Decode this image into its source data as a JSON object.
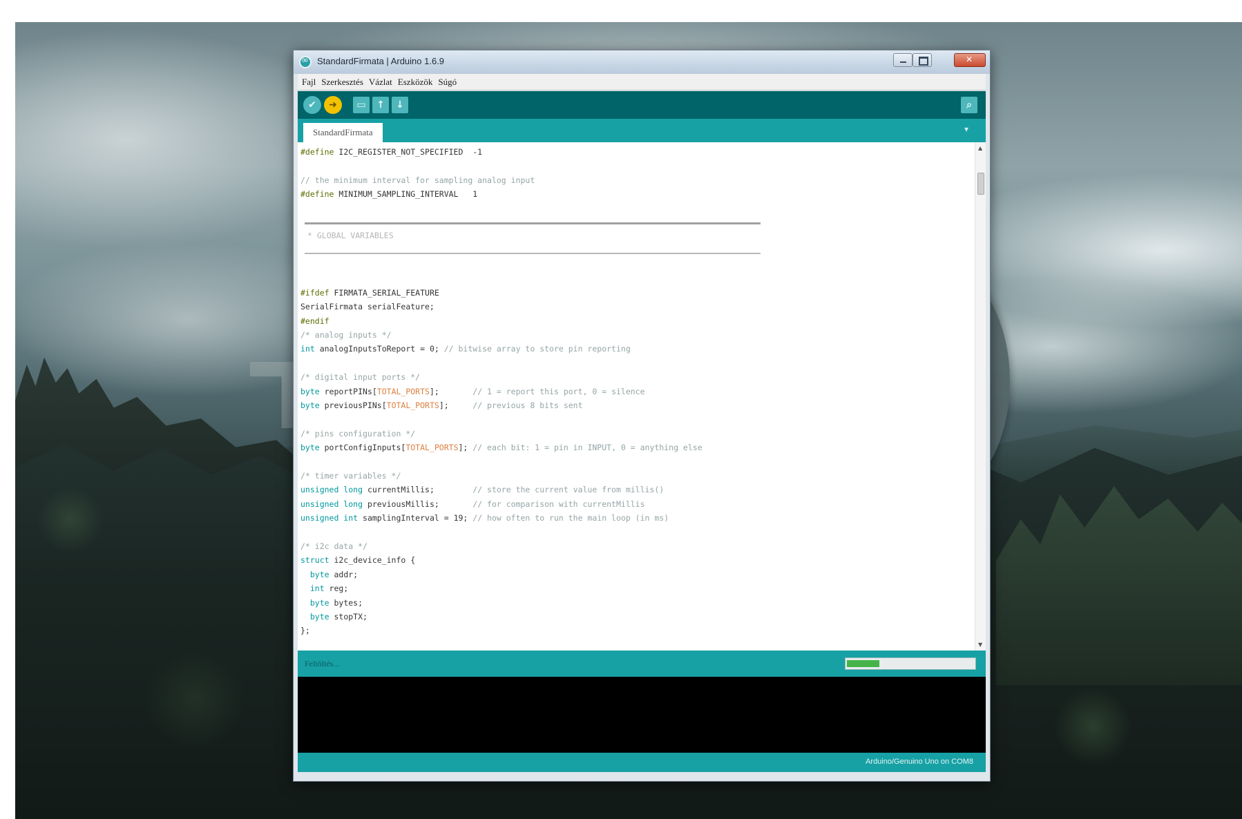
{
  "window": {
    "title": "StandardFirmata | Arduino 1.6.9"
  },
  "menu": [
    "Fajl",
    "Szerkesztés",
    "Vázlat",
    "Eszközök",
    "Súgó"
  ],
  "toolbar": {
    "verify_icon": "✔",
    "upload_icon": "➜",
    "new_icon": "▭",
    "open_icon": "↑",
    "save_icon": "↓",
    "serial_monitor_icon": "⌕"
  },
  "tabs": [
    {
      "label": "StandardFirmata"
    }
  ],
  "tab_menu_icon": "▾",
  "code_lines": [
    [
      [
        "pp",
        "#define"
      ],
      [
        "",
        " I2C_REGISTER_NOT_SPECIFIED  -1"
      ]
    ],
    [
      [
        "",
        ""
      ]
    ],
    [
      [
        "cm",
        "// the minimum interval for sampling analog input"
      ]
    ],
    [
      [
        "pp",
        "#define"
      ],
      [
        "",
        " MINIMUM_SAMPLING_INTERVAL   1"
      ]
    ],
    [
      [
        "",
        ""
      ]
    ],
    [
      [
        "",
        ""
      ]
    ],
    [
      [
        "",
        ""
      ]
    ],
    [
      [
        "",
        ""
      ]
    ],
    [
      [
        "",
        ""
      ]
    ],
    [
      [
        "",
        ""
      ]
    ],
    [
      [
        "pp",
        "#ifdef"
      ],
      [
        "",
        " FIRMATA_SERIAL_FEATURE"
      ]
    ],
    [
      [
        "",
        "SerialFirmata serialFeature;"
      ]
    ],
    [
      [
        "pp",
        "#endif"
      ]
    ],
    [
      [
        "cm",
        "/* analog inputs */"
      ]
    ],
    [
      [
        "kw",
        "int"
      ],
      [
        "",
        " analogInputsToReport = 0; "
      ],
      [
        "cm",
        "// bitwise array to store pin reporting"
      ]
    ],
    [
      [
        "",
        ""
      ]
    ],
    [
      [
        "cm",
        "/* digital input ports */"
      ]
    ],
    [
      [
        "kw",
        "byte"
      ],
      [
        "",
        " reportPINs["
      ],
      [
        "cst",
        "TOTAL_PORTS"
      ],
      [
        "",
        "];       "
      ],
      [
        "cm",
        "// 1 = report this port, 0 = silence"
      ]
    ],
    [
      [
        "kw",
        "byte"
      ],
      [
        "",
        " previousPINs["
      ],
      [
        "cst",
        "TOTAL_PORTS"
      ],
      [
        "",
        "];     "
      ],
      [
        "cm",
        "// previous 8 bits sent"
      ]
    ],
    [
      [
        "",
        ""
      ]
    ],
    [
      [
        "cm",
        "/* pins configuration */"
      ]
    ],
    [
      [
        "kw",
        "byte"
      ],
      [
        "",
        " portConfigInputs["
      ],
      [
        "cst",
        "TOTAL_PORTS"
      ],
      [
        "",
        "]; "
      ],
      [
        "cm",
        "// each bit: 1 = pin in INPUT, 0 = anything else"
      ]
    ],
    [
      [
        "",
        ""
      ]
    ],
    [
      [
        "cm",
        "/* timer variables */"
      ]
    ],
    [
      [
        "kw",
        "unsigned long"
      ],
      [
        "",
        " currentMillis;        "
      ],
      [
        "cm",
        "// store the current value from millis()"
      ]
    ],
    [
      [
        "kw",
        "unsigned long"
      ],
      [
        "",
        " previousMillis;       "
      ],
      [
        "cm",
        "// for comparison with currentMillis"
      ]
    ],
    [
      [
        "kw",
        "unsigned int"
      ],
      [
        "",
        " samplingInterval = 19; "
      ],
      [
        "cm",
        "// how often to run the main loop (in ms)"
      ]
    ],
    [
      [
        "",
        ""
      ]
    ],
    [
      [
        "cm",
        "/* i2c data */"
      ]
    ],
    [
      [
        "kw",
        "struct"
      ],
      [
        "",
        " i2c_device_info {"
      ]
    ],
    [
      [
        "kw",
        "  byte"
      ],
      [
        "",
        " addr;"
      ]
    ],
    [
      [
        "kw",
        "  int"
      ],
      [
        "",
        " reg;"
      ]
    ],
    [
      [
        "kw",
        "  byte"
      ],
      [
        "",
        " bytes;"
      ]
    ],
    [
      [
        "kw",
        "  byte"
      ],
      [
        "",
        " stopTX;"
      ]
    ],
    [
      [
        "",
        "};"
      ]
    ]
  ],
  "code_banner": "* GLOBAL VARIABLES",
  "status": {
    "text": "Feltöltés...",
    "progress": 0.25
  },
  "bottom": {
    "board_info": "Arduino/Genuino Uno on COM8"
  }
}
